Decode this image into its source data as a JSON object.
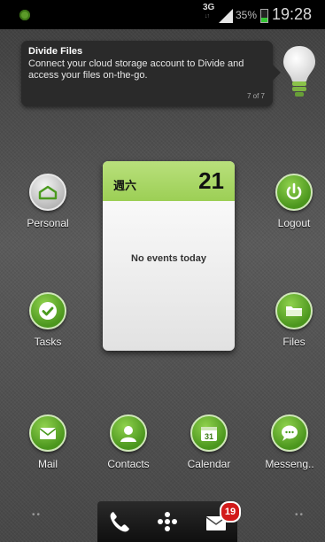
{
  "status_bar": {
    "network": "3G",
    "network_arrows": "↓↑",
    "battery_percent": "35%",
    "battery_level": 0.35,
    "time": "19:28"
  },
  "notification": {
    "title": "Divide Files",
    "body": "Connect your cloud storage account to Divide and access your files on-the-go.",
    "page": "7 of 7"
  },
  "apps": {
    "personal": "Personal",
    "logout": "Logout",
    "tasks": "Tasks",
    "files": "Files",
    "mail": "Mail",
    "contacts": "Contacts",
    "calendar": "Calendar",
    "calendar_icon_day": "31",
    "messenger": "Messeng.."
  },
  "calendar_widget": {
    "weekday": "週六",
    "date": "21",
    "message": "No events today"
  },
  "dock": {
    "mail_badge": "19",
    "page_dots_left": "••",
    "page_dots_right": "••"
  },
  "colors": {
    "accent_green": "#5fae27",
    "badge_red": "#d21a1a"
  }
}
